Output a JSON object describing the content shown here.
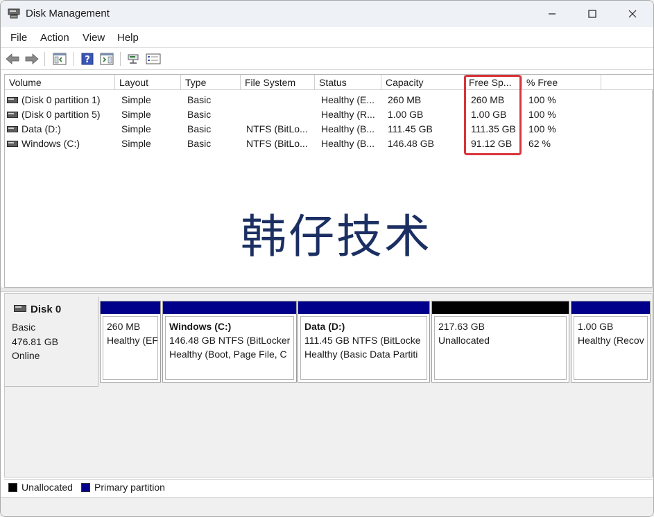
{
  "window": {
    "title": "Disk Management"
  },
  "menu": [
    "File",
    "Action",
    "View",
    "Help"
  ],
  "columns": [
    "Volume",
    "Layout",
    "Type",
    "File System",
    "Status",
    "Capacity",
    "Free Sp...",
    "% Free"
  ],
  "volumes": [
    {
      "volume": "(Disk 0 partition 1)",
      "layout": "Simple",
      "type": "Basic",
      "fs": "",
      "status": "Healthy (E...",
      "capacity": "260 MB",
      "free": "260 MB",
      "pct": "100 %"
    },
    {
      "volume": "(Disk 0 partition 5)",
      "layout": "Simple",
      "type": "Basic",
      "fs": "",
      "status": "Healthy (R...",
      "capacity": "1.00 GB",
      "free": "1.00 GB",
      "pct": "100 %"
    },
    {
      "volume": "Data (D:)",
      "layout": "Simple",
      "type": "Basic",
      "fs": "NTFS (BitLo...",
      "status": "Healthy (B...",
      "capacity": "111.45 GB",
      "free": "111.35 GB",
      "pct": "100 %"
    },
    {
      "volume": "Windows (C:)",
      "layout": "Simple",
      "type": "Basic",
      "fs": "NTFS (BitLo...",
      "status": "Healthy (B...",
      "capacity": "146.48 GB",
      "free": "91.12 GB",
      "pct": "62 %"
    }
  ],
  "watermark": "韩仔技术",
  "disk": {
    "name": "Disk 0",
    "kind": "Basic",
    "size": "476.81 GB",
    "state": "Online"
  },
  "partitions": [
    {
      "title": "",
      "line1": "260 MB",
      "line2": "Healthy (EFI"
    },
    {
      "title": "Windows  (C:)",
      "line1": "146.48 GB NTFS (BitLocker",
      "line2": "Healthy (Boot, Page File, C"
    },
    {
      "title": "Data  (D:)",
      "line1": "111.45 GB NTFS (BitLocke",
      "line2": "Healthy (Basic Data Partiti"
    },
    {
      "title": "",
      "line1": "217.63 GB",
      "line2": "Unallocated"
    },
    {
      "title": "",
      "line1": "1.00 GB",
      "line2": "Healthy (Recov"
    }
  ],
  "legend": {
    "unallocated": "Unallocated",
    "primary": "Primary partition"
  },
  "colors": {
    "primary": "#00008b",
    "unallocated": "#000000",
    "highlight": "#d9343a",
    "watermark": "#1b2f62"
  }
}
